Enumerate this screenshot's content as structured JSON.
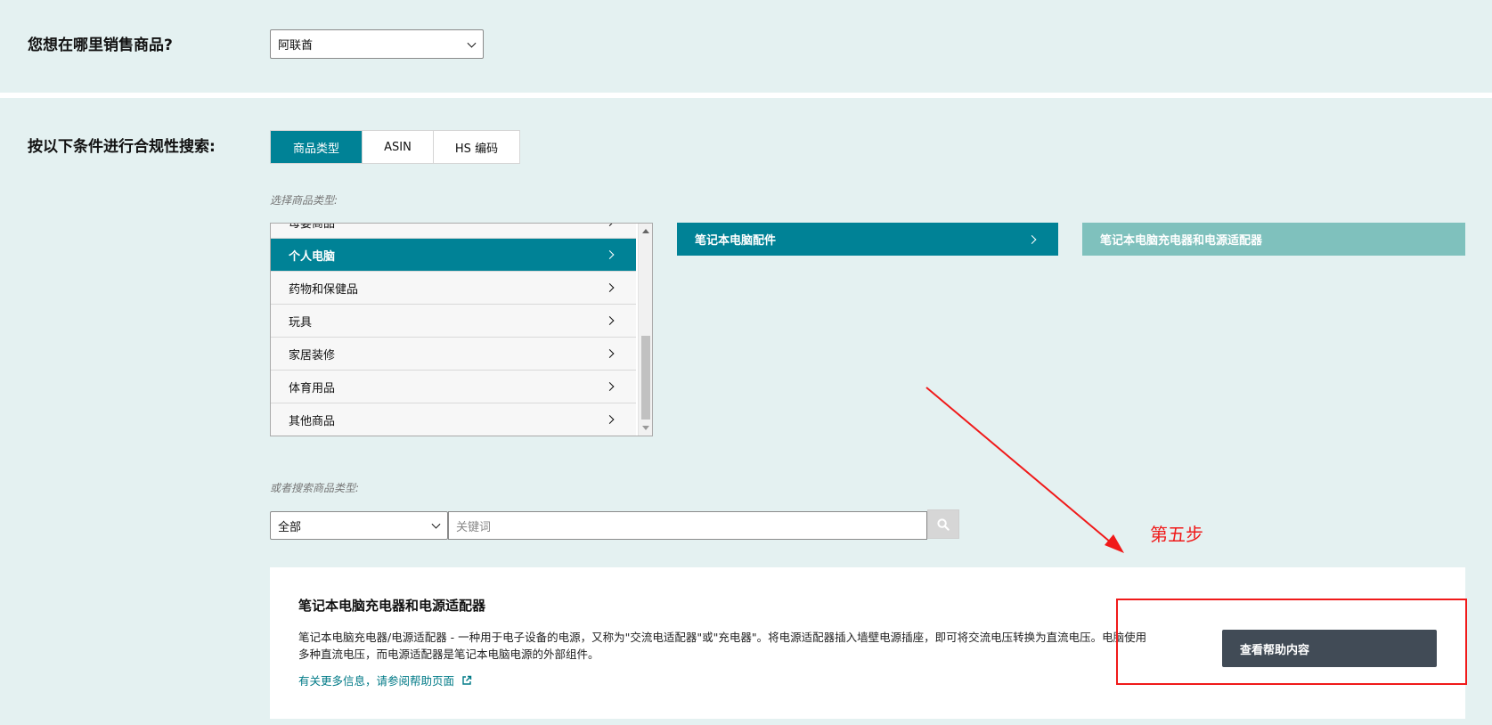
{
  "marketplace": {
    "label": "您想在哪里销售商品?",
    "selected": "阿联酋"
  },
  "compliance_search": {
    "label": "按以下条件进行合规性搜索:",
    "tabs": [
      {
        "label": "商品类型",
        "active": true
      },
      {
        "label": "ASIN",
        "active": false
      },
      {
        "label": "HS 编码",
        "active": false
      }
    ],
    "select_hint": "选择商品类型:",
    "partial_item": "母婴商品",
    "categories": [
      {
        "label": "个人电脑",
        "active": true
      },
      {
        "label": "药物和保健品",
        "active": false
      },
      {
        "label": "玩具",
        "active": false
      },
      {
        "label": "家居装修",
        "active": false
      },
      {
        "label": "体育用品",
        "active": false
      },
      {
        "label": "其他商品",
        "active": false
      }
    ],
    "subcategory": "笔记本电脑配件",
    "sub_subcategory": "笔记本电脑充电器和电源适配器",
    "search_hint": "或者搜索商品类型:",
    "scope_selected": "全部",
    "keyword_placeholder": "关键词"
  },
  "result_card": {
    "title": "笔记本电脑充电器和电源适配器",
    "description": "笔记本电脑充电器/电源适配器 - 一种用于电子设备的电源，又称为\"交流电适配器\"或\"充电器\"。将电源适配器插入墙壁电源插座，即可将交流电压转换为直流电压。电脑使用多种直流电压，而电源适配器是笔记本电脑电源的外部组件。",
    "help_link": "有关更多信息，请参阅帮助页面",
    "help_button": "查看帮助内容"
  },
  "annotation": {
    "step_label": "第五步"
  },
  "colors": {
    "background": "#e4f1f1",
    "accent": "#008296",
    "accent_light": "#7fc1bd",
    "button_dark": "#414b56",
    "annotation_red": "#f01a1a"
  },
  "icons": {
    "dropdown": "chevron-down-icon",
    "list_arrow": "chevron-right-icon",
    "search": "search-icon",
    "external_link": "external-link-icon"
  }
}
